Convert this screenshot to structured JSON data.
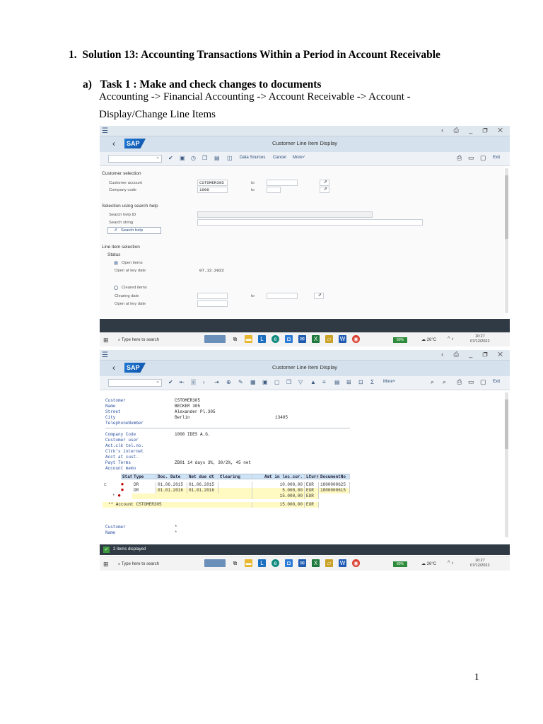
{
  "heading": "1.  Solution 13: Accounting Transactions Within a Period in Account Receivable",
  "task": "a)   Task 1 : Make and check changes to documents",
  "path_line1": "Accounting -> Financial Accounting -> Account Receivable -> Account -",
  "path_line2": "Display/Change Line Items",
  "page_number": "1",
  "sap_common": {
    "logo": "SAP",
    "title": "Customer Line Item Display",
    "exit": "Exit",
    "taskbar_search": "Type here to search",
    "battery": "80%",
    "temperature": "26°C",
    "time": "10:27",
    "date": "07/12/2022"
  },
  "screen1": {
    "toolbar": {
      "data_sources": "Data Sources",
      "cancel": "Cancel",
      "more": "More˅"
    },
    "customer_selection": {
      "title": "Customer selection",
      "customer_account_label": "Customer account",
      "customer_account_value": "CSTOMER305",
      "company_code_label": "Company code",
      "company_code_value": "1000",
      "to1": "to",
      "to2": "to"
    },
    "search_help": {
      "title": "Selection using search help",
      "id_label": "Search help ID",
      "string_label": "Search string",
      "button": "Search help"
    },
    "line_item": {
      "title": "Line item selection",
      "status": "Status",
      "open_items": "Open items",
      "open_key_date_label": "Open at key date",
      "open_key_date_value": "07.12.2022",
      "cleared_items": "Cleared items",
      "clearing_date_label": "Clearing date",
      "clearing_to": "to",
      "open_key_date2_label": "Open at key date"
    }
  },
  "screen2": {
    "toolbar": {
      "more": "More˅"
    },
    "header": [
      {
        "k": "Customer",
        "v": "CSTOMER305"
      },
      {
        "k": "Name",
        "v": "BECKER 305"
      },
      {
        "k": "Street",
        "v": "Alexander Pl.305"
      },
      {
        "k": "City",
        "v": "Berlin"
      },
      {
        "k": "TelephoneNumber",
        "v": ""
      }
    ],
    "postal_code": "13405",
    "details": [
      {
        "k": "Company Code",
        "v": "1000 IDES A.G."
      },
      {
        "k": "Customer user",
        "v": ""
      },
      {
        "k": "Act.clk tel.no.",
        "v": ""
      },
      {
        "k": "Clrk's internet",
        "v": ""
      },
      {
        "k": "Acct at cust.",
        "v": ""
      },
      {
        "k": "Payt Terms",
        "v": "ZB01 14 days 3%, 30/2%, 45 net"
      },
      {
        "k": "Account memo",
        "v": ""
      }
    ],
    "table": {
      "columns": [
        "Stat",
        "Type",
        "Doc. Date",
        "Net due dt",
        "Clearing",
        "Amt in loc.cur.",
        "LCurr",
        "DocumentNo"
      ],
      "rows": [
        {
          "type": "DR",
          "doc_date": "01.06.2015",
          "net_due": "01.06.2015",
          "amount": "10.000,00",
          "curr": "EUR",
          "docno": "1800000625"
        },
        {
          "type": "DR",
          "doc_date": "01.01.2016",
          "net_due": "01.01.2016",
          "amount": "5.000,00",
          "curr": "EUR",
          "docno": "1800000615"
        }
      ],
      "subtotal_mark": "*",
      "subtotal_amount": "15.000,00",
      "subtotal_curr": "EUR",
      "total_label": "** Account CSTOMER305",
      "total_amount": "15.000,00",
      "total_curr": "EUR"
    },
    "footer": [
      {
        "k": "Customer",
        "v": "*"
      },
      {
        "k": "Name",
        "v": "*"
      }
    ],
    "status_msg": "2 items displayed"
  }
}
